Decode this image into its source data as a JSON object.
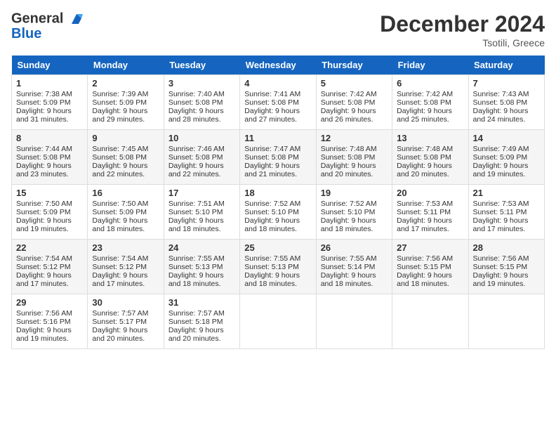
{
  "header": {
    "logo_line1": "General",
    "logo_line2": "Blue",
    "month": "December 2024",
    "location": "Tsotili, Greece"
  },
  "weekdays": [
    "Sunday",
    "Monday",
    "Tuesday",
    "Wednesday",
    "Thursday",
    "Friday",
    "Saturday"
  ],
  "weeks": [
    [
      {
        "day": "1",
        "info": "Sunrise: 7:38 AM\nSunset: 5:09 PM\nDaylight: 9 hours\nand 31 minutes."
      },
      {
        "day": "2",
        "info": "Sunrise: 7:39 AM\nSunset: 5:09 PM\nDaylight: 9 hours\nand 29 minutes."
      },
      {
        "day": "3",
        "info": "Sunrise: 7:40 AM\nSunset: 5:08 PM\nDaylight: 9 hours\nand 28 minutes."
      },
      {
        "day": "4",
        "info": "Sunrise: 7:41 AM\nSunset: 5:08 PM\nDaylight: 9 hours\nand 27 minutes."
      },
      {
        "day": "5",
        "info": "Sunrise: 7:42 AM\nSunset: 5:08 PM\nDaylight: 9 hours\nand 26 minutes."
      },
      {
        "day": "6",
        "info": "Sunrise: 7:42 AM\nSunset: 5:08 PM\nDaylight: 9 hours\nand 25 minutes."
      },
      {
        "day": "7",
        "info": "Sunrise: 7:43 AM\nSunset: 5:08 PM\nDaylight: 9 hours\nand 24 minutes."
      }
    ],
    [
      {
        "day": "8",
        "info": "Sunrise: 7:44 AM\nSunset: 5:08 PM\nDaylight: 9 hours\nand 23 minutes."
      },
      {
        "day": "9",
        "info": "Sunrise: 7:45 AM\nSunset: 5:08 PM\nDaylight: 9 hours\nand 22 minutes."
      },
      {
        "day": "10",
        "info": "Sunrise: 7:46 AM\nSunset: 5:08 PM\nDaylight: 9 hours\nand 22 minutes."
      },
      {
        "day": "11",
        "info": "Sunrise: 7:47 AM\nSunset: 5:08 PM\nDaylight: 9 hours\nand 21 minutes."
      },
      {
        "day": "12",
        "info": "Sunrise: 7:48 AM\nSunset: 5:08 PM\nDaylight: 9 hours\nand 20 minutes."
      },
      {
        "day": "13",
        "info": "Sunrise: 7:48 AM\nSunset: 5:08 PM\nDaylight: 9 hours\nand 20 minutes."
      },
      {
        "day": "14",
        "info": "Sunrise: 7:49 AM\nSunset: 5:09 PM\nDaylight: 9 hours\nand 19 minutes."
      }
    ],
    [
      {
        "day": "15",
        "info": "Sunrise: 7:50 AM\nSunset: 5:09 PM\nDaylight: 9 hours\nand 19 minutes."
      },
      {
        "day": "16",
        "info": "Sunrise: 7:50 AM\nSunset: 5:09 PM\nDaylight: 9 hours\nand 18 minutes."
      },
      {
        "day": "17",
        "info": "Sunrise: 7:51 AM\nSunset: 5:10 PM\nDaylight: 9 hours\nand 18 minutes."
      },
      {
        "day": "18",
        "info": "Sunrise: 7:52 AM\nSunset: 5:10 PM\nDaylight: 9 hours\nand 18 minutes."
      },
      {
        "day": "19",
        "info": "Sunrise: 7:52 AM\nSunset: 5:10 PM\nDaylight: 9 hours\nand 18 minutes."
      },
      {
        "day": "20",
        "info": "Sunrise: 7:53 AM\nSunset: 5:11 PM\nDaylight: 9 hours\nand 17 minutes."
      },
      {
        "day": "21",
        "info": "Sunrise: 7:53 AM\nSunset: 5:11 PM\nDaylight: 9 hours\nand 17 minutes."
      }
    ],
    [
      {
        "day": "22",
        "info": "Sunrise: 7:54 AM\nSunset: 5:12 PM\nDaylight: 9 hours\nand 17 minutes."
      },
      {
        "day": "23",
        "info": "Sunrise: 7:54 AM\nSunset: 5:12 PM\nDaylight: 9 hours\nand 17 minutes."
      },
      {
        "day": "24",
        "info": "Sunrise: 7:55 AM\nSunset: 5:13 PM\nDaylight: 9 hours\nand 18 minutes."
      },
      {
        "day": "25",
        "info": "Sunrise: 7:55 AM\nSunset: 5:13 PM\nDaylight: 9 hours\nand 18 minutes."
      },
      {
        "day": "26",
        "info": "Sunrise: 7:55 AM\nSunset: 5:14 PM\nDaylight: 9 hours\nand 18 minutes."
      },
      {
        "day": "27",
        "info": "Sunrise: 7:56 AM\nSunset: 5:15 PM\nDaylight: 9 hours\nand 18 minutes."
      },
      {
        "day": "28",
        "info": "Sunrise: 7:56 AM\nSunset: 5:15 PM\nDaylight: 9 hours\nand 19 minutes."
      }
    ],
    [
      {
        "day": "29",
        "info": "Sunrise: 7:56 AM\nSunset: 5:16 PM\nDaylight: 9 hours\nand 19 minutes."
      },
      {
        "day": "30",
        "info": "Sunrise: 7:57 AM\nSunset: 5:17 PM\nDaylight: 9 hours\nand 20 minutes."
      },
      {
        "day": "31",
        "info": "Sunrise: 7:57 AM\nSunset: 5:18 PM\nDaylight: 9 hours\nand 20 minutes."
      },
      {
        "day": "",
        "info": ""
      },
      {
        "day": "",
        "info": ""
      },
      {
        "day": "",
        "info": ""
      },
      {
        "day": "",
        "info": ""
      }
    ]
  ]
}
